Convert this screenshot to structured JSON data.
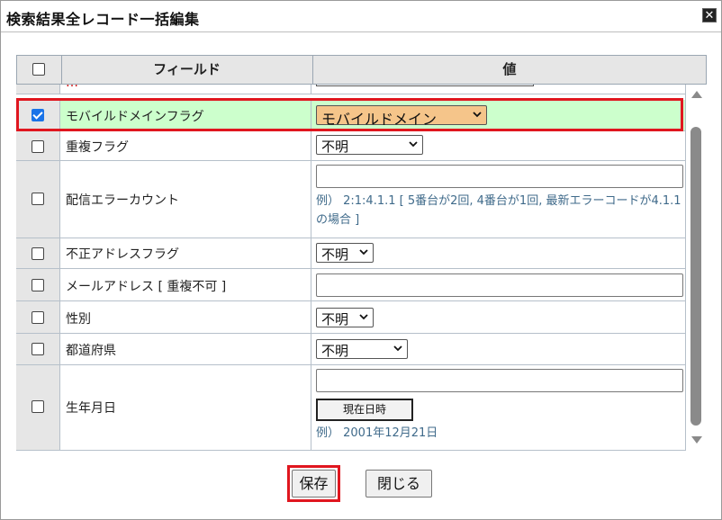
{
  "dialog": {
    "title": "検索結果全レコード一括編集",
    "close_icon": "close-icon"
  },
  "table": {
    "headers": {
      "field": "フィールド",
      "value": "値"
    },
    "partial_row": {
      "field": "…",
      "value": "…"
    },
    "rows": [
      {
        "label": "モバイルドメインフラグ",
        "checked": true,
        "selected": "モバイルドメイン"
      },
      {
        "label": "重複フラグ",
        "checked": false,
        "selected": "不明"
      },
      {
        "label": "配信エラーカウント",
        "checked": false,
        "input_value": "",
        "hint": "例） 2:1:4.1.1 [ 5番台が2回, 4番台が1回, 最新エラーコードが4.1.1の場合 ]"
      },
      {
        "label": "不正アドレスフラグ",
        "checked": false,
        "selected": "不明"
      },
      {
        "label": "メールアドレス [ 重複不可 ]",
        "checked": false,
        "input_value": ""
      },
      {
        "label": "性別",
        "checked": false,
        "selected": "不明"
      },
      {
        "label": "都道府県",
        "checked": false,
        "selected": "不明"
      },
      {
        "label": "生年月日",
        "checked": false,
        "input_value": "",
        "now_button": "現在日時",
        "hint": "例） 2001年12月21日"
      }
    ]
  },
  "buttons": {
    "save": "保存",
    "close": "閉じる"
  },
  "colors": {
    "highlight": "#e0161f",
    "checked_row_bg": "#ccffcc",
    "select_accent": "#f5c58a"
  }
}
